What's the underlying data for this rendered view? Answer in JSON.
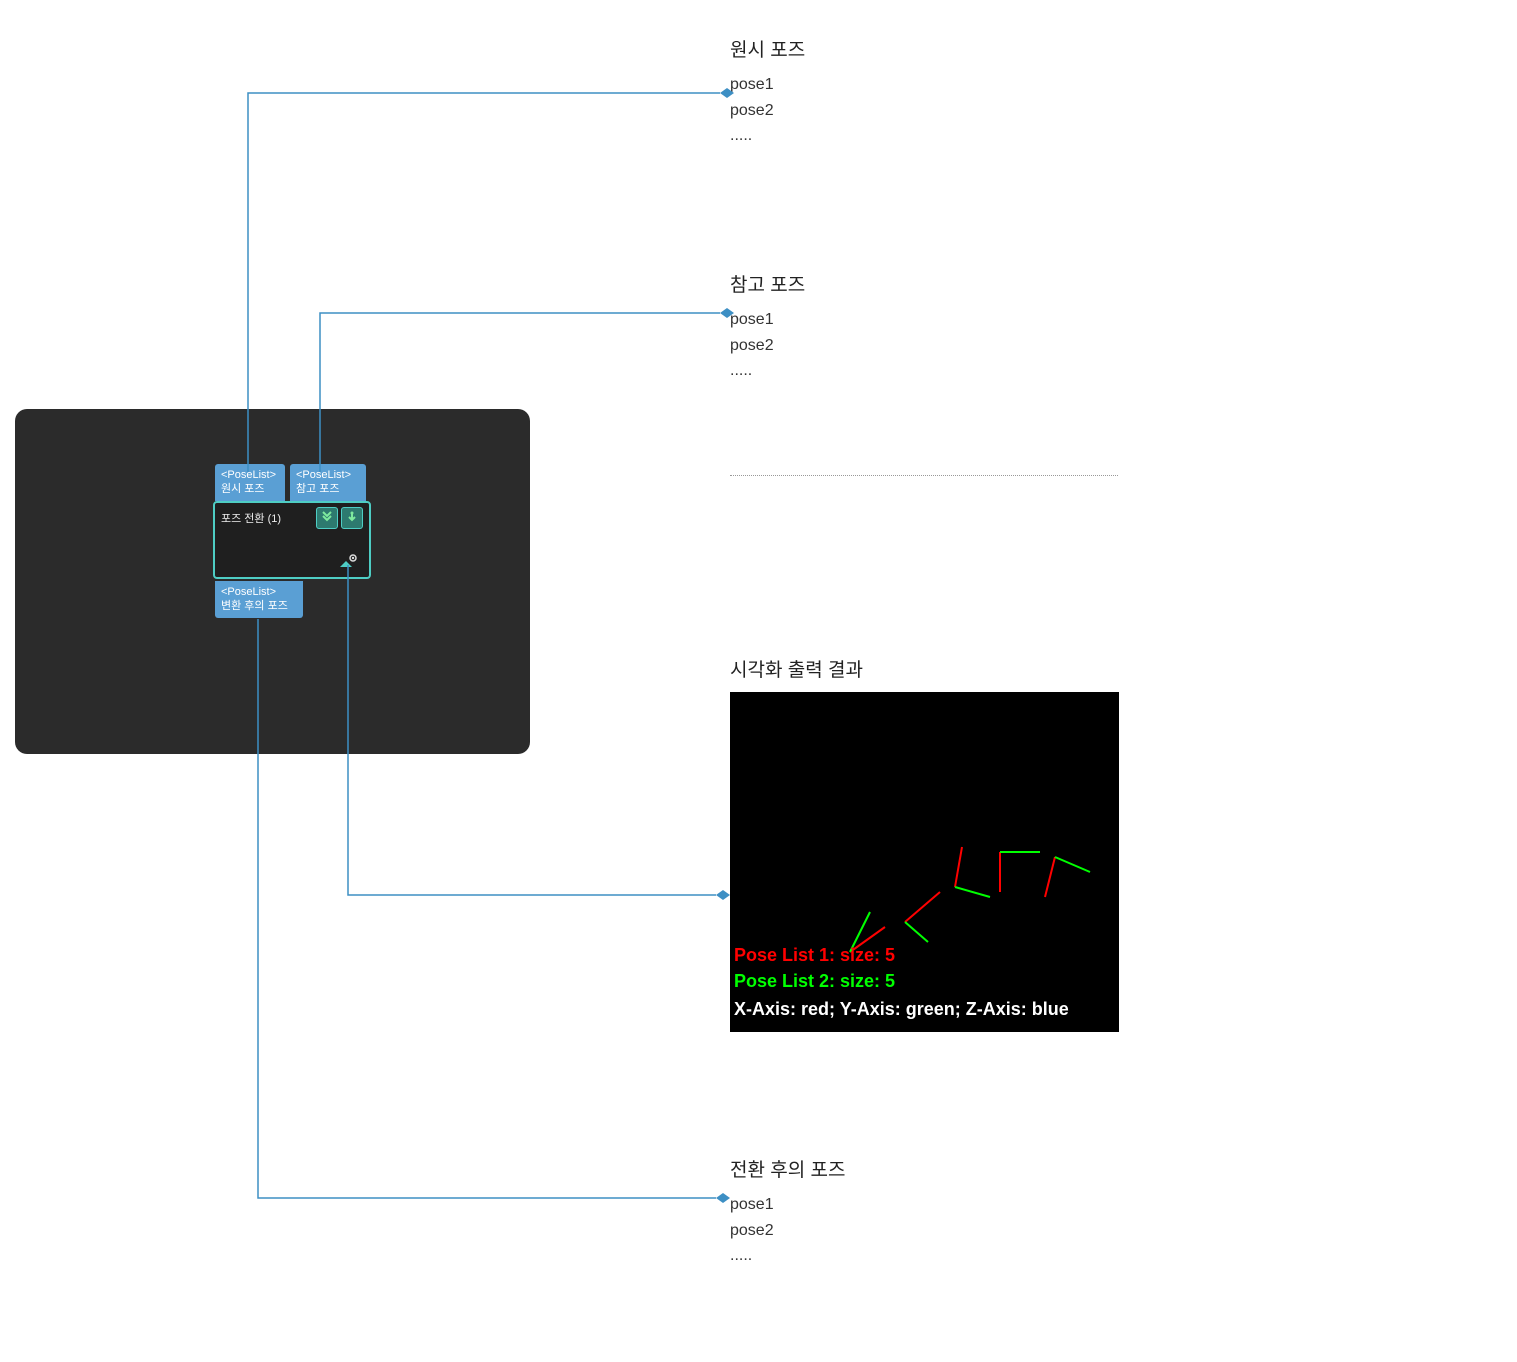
{
  "sections": {
    "raw_pose": {
      "title": "원시 포즈",
      "items": [
        "pose1",
        "pose2",
        "....."
      ]
    },
    "ref_pose": {
      "title": "참고 포즈",
      "items": [
        "pose1",
        "pose2",
        "....."
      ]
    },
    "viz_output": {
      "title": "시각화 출력 결과",
      "text1": "Pose List 1: size: 5",
      "text2": "Pose List 2: size: 5",
      "text3": "X-Axis: red; Y-Axis: green; Z-Axis: blue"
    },
    "transformed_pose": {
      "title": "전환 후의 포즈",
      "items": [
        "pose1",
        "pose2",
        "....."
      ]
    }
  },
  "node": {
    "input1_type": "<PoseList>",
    "input1_label": "원시 포즈",
    "input2_type": "<PoseList>",
    "input2_label": "참고 포즈",
    "title": "포즈 전환 (1)",
    "output_type": "<PoseList>",
    "output_label": "변환 후의 포즈"
  },
  "icons": {
    "dropdown": "dropdown-icon",
    "download": "download-icon",
    "eye": "eye-icon"
  }
}
